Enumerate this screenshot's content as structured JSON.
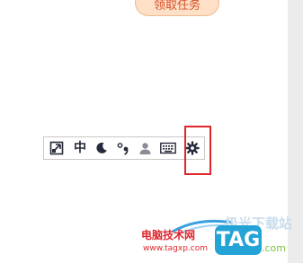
{
  "page": {
    "task_button_label": "领取任务"
  },
  "ime_toolbar": {
    "items": [
      {
        "name": "ime-logo",
        "icon": "ime-logo-icon"
      },
      {
        "name": "chinese-mode",
        "label": "中"
      },
      {
        "name": "half-width",
        "icon": "moon-icon"
      },
      {
        "name": "punctuation",
        "icon": "chinese-punctuation-icon"
      },
      {
        "name": "account",
        "icon": "user-icon"
      },
      {
        "name": "soft-keyboard",
        "icon": "keyboard-icon"
      },
      {
        "name": "settings",
        "icon": "gear-icon"
      }
    ]
  },
  "highlight": {
    "color": "#e0252c"
  },
  "watermark": {
    "site_name": "电脑技术网",
    "url": "www.tagxp.com",
    "faded_text": "极光下载站",
    "logo_text": "TAG",
    "domain": ".com"
  },
  "colors": {
    "task_button_bg": "#fde0c6",
    "task_button_text": "#d8502a",
    "toolbar_icon": "#262a3a",
    "tag_logo": "#24a3d6",
    "domain_green": "#7bc043"
  }
}
